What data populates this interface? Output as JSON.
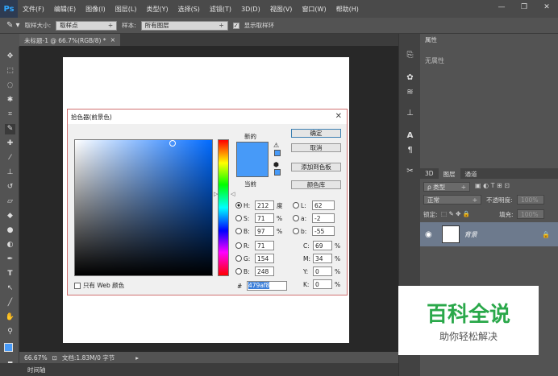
{
  "menubar": {
    "logo": "Ps",
    "items": [
      "文件(F)",
      "编辑(E)",
      "图像(I)",
      "图层(L)",
      "类型(Y)",
      "选择(S)",
      "滤镜(T)",
      "3D(D)",
      "视图(V)",
      "窗口(W)",
      "帮助(H)"
    ],
    "minimize": "—",
    "restore": "❐",
    "close": "✕"
  },
  "options": {
    "sample_size_label": "取样大小:",
    "sample_size_value": "取样点",
    "sample_label": "样本:",
    "sample_value": "所有图层",
    "show_ring_label": "显示取样环",
    "show_ring_checked": true
  },
  "document": {
    "tab_title": "未标题-1 @ 66.7%(RGB/8) *",
    "tab_close": "×"
  },
  "status": {
    "zoom": "66.67%",
    "doc_info": "文档:1.83M/0 字节",
    "timeline": "时间轴"
  },
  "panels": {
    "properties_tab": "属性",
    "properties_empty": "无属性",
    "tabs": [
      "3D",
      "图层",
      "通道"
    ],
    "active_tab": "图层",
    "filter_kind": "ρ 类型",
    "blend_mode": "正常",
    "opacity_label": "不透明度:",
    "opacity_value": "100%",
    "lock_label": "锁定:",
    "fill_label": "填充:",
    "fill_value": "100%",
    "layer_name": "背景"
  },
  "dialog": {
    "title": "拾色器(前景色)",
    "close": "✕",
    "new_label": "新的",
    "current_label": "当前",
    "ok": "确定",
    "cancel": "取消",
    "add_swatch": "添加到色板",
    "color_libraries": "颜色库",
    "web_only_label": "只有 Web 颜色",
    "hsb": {
      "h_label": "H:",
      "h_value": "212",
      "h_unit": "度",
      "s_label": "S:",
      "s_value": "71",
      "s_unit": "%",
      "b_label": "B:",
      "b_value": "97",
      "b_unit": "%"
    },
    "rgb": {
      "r_label": "R:",
      "r_value": "71",
      "g_label": "G:",
      "g_value": "154",
      "b_label": "B:",
      "b_value": "248"
    },
    "lab": {
      "l_label": "L:",
      "l_value": "62",
      "a_label": "a:",
      "a_value": "-2",
      "b_label": "b:",
      "b_value": "-55"
    },
    "cmyk": {
      "c_label": "C:",
      "c_value": "69",
      "c_unit": "%",
      "m_label": "M:",
      "m_value": "34",
      "m_unit": "%",
      "y_label": "Y:",
      "y_value": "0",
      "y_unit": "%",
      "k_label": "K:",
      "k_value": "0",
      "k_unit": "%"
    },
    "hex_label": "#",
    "hex_value": "479af8",
    "color": "#479af8",
    "selected_mode": "H"
  },
  "watermark": {
    "title": "百科全说",
    "subtitle": "助你轻松解决"
  }
}
